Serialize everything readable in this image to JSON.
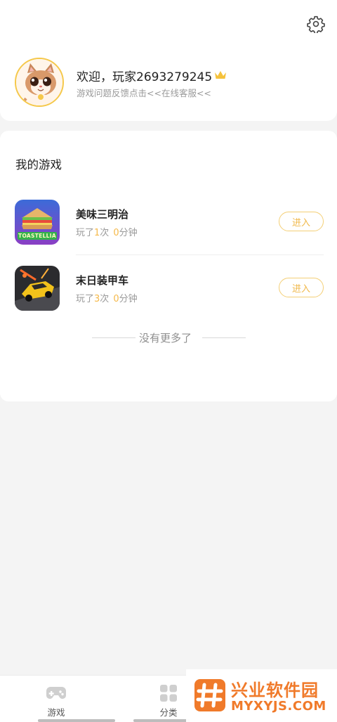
{
  "profile": {
    "welcome": "欢迎，玩家2693279245",
    "feedback": "游戏问题反馈点击<<在线客服<<"
  },
  "my_games": {
    "title": "我的游戏",
    "items": [
      {
        "name": "美味三明治",
        "played_prefix": "玩了",
        "times": "1",
        "times_unit": "次",
        "minutes": "0",
        "minutes_unit": "分钟",
        "button": "进入",
        "icon": "sandwich-game-icon",
        "logo_text": "TOASTELLIA"
      },
      {
        "name": "末日装甲车",
        "played_prefix": "玩了",
        "times": "3",
        "times_unit": "次",
        "minutes": "0",
        "minutes_unit": "分钟",
        "button": "进入",
        "icon": "armored-car-game-icon"
      }
    ],
    "end_text": "没有更多了"
  },
  "nav": {
    "items": [
      {
        "label": "游戏",
        "icon": "gamepad-icon"
      },
      {
        "label": "分类",
        "icon": "grid-icon"
      }
    ]
  },
  "watermark": {
    "cn": "兴业软件园",
    "en": "MYXYJS.COM"
  },
  "colors": {
    "accent": "#f5b94a",
    "button_border": "#f4cf76",
    "watermark": "#f07a2a"
  }
}
